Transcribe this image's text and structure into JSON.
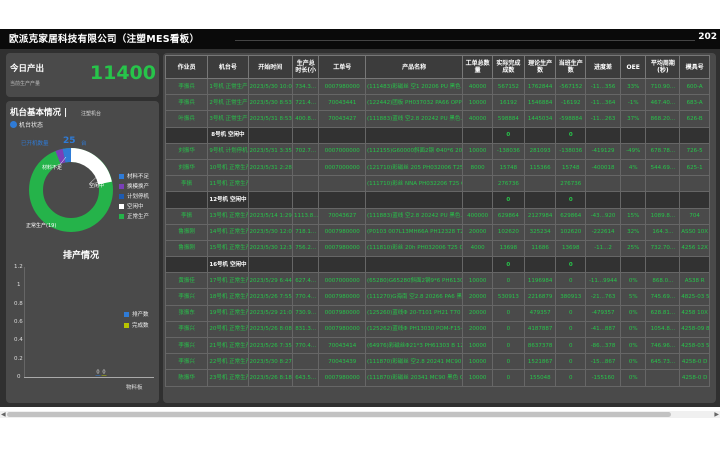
{
  "header": {
    "title": "欧派克家居科技有限公司（注塑MES看板）",
    "year": "202"
  },
  "today": {
    "title": "今日产出",
    "sub": "当前生产产量",
    "value": "11400"
  },
  "machine": {
    "title": "机台基本情况 |",
    "subtab": "注塑机台",
    "status_label": "机台状态",
    "count_label": "已开机数量",
    "count_value": "25",
    "count_unit": "台",
    "legend": [
      {
        "label": "材料不足",
        "color": "#2f7bd6"
      },
      {
        "label": "换模换产",
        "color": "#7a3fb8"
      },
      {
        "label": "计划停机",
        "color": "#1e5bb0"
      },
      {
        "label": "空闲中",
        "color": "#ffffff"
      },
      {
        "label": "正常生产",
        "color": "#25b34a"
      }
    ],
    "donut_labels": {
      "a": "材料不足",
      "b": "空闲中",
      "c": "正常生产(19)"
    }
  },
  "chart_data": {
    "type": "bar",
    "title": "排产情况",
    "categories": [
      "物料板"
    ],
    "series": [
      {
        "name": "排产数",
        "color": "#2f7bd6",
        "values": [
          0
        ]
      },
      {
        "name": "完成数",
        "color": "#b8c400",
        "values": [
          0
        ]
      }
    ],
    "ylim": [
      0,
      1.2
    ],
    "yticks": [
      "1.2",
      "1",
      "0.8",
      "0.6",
      "0.4",
      "0.2",
      "0"
    ]
  },
  "table": {
    "headers": [
      "作业员",
      "机台号",
      "开始时间",
      "生产总时长(小",
      "工单号",
      "产品名称",
      "工单总数量",
      "实际完成成数",
      "理论生产数",
      "当班生产数",
      "进度差",
      "OEE",
      "平均周期(秒)",
      "模具号"
    ],
    "rows": [
      {
        "cls": "",
        "cells": [
          "李振兵",
          "1号机 正常生产",
          "2023/5/30 10:00",
          "734.3...",
          "0007980000",
          "(111483)彩磁丝 空1 20206 PU 黑色 C05161E40660...",
          "40000",
          "567152",
          "1762844",
          "-567152",
          "-11...356",
          "33%",
          "710.90...",
          "600-A"
        ]
      },
      {
        "cls": "",
        "cells": [
          "李振兵",
          "2号机 正常生产",
          "2023/5/30 8:53",
          "721.4...",
          "70043441",
          "(122442)团板 PH037032 PA66 OPP05 5...",
          "10000",
          "16192",
          "1546884",
          "-16192",
          "-11...364",
          "-1%",
          "467.40...",
          "683-A"
        ]
      },
      {
        "cls": "",
        "cells": [
          "叶振兵",
          "3号机 正常生产",
          "2023/5/31 8:53",
          "400.8...",
          "70043427",
          "(111883)蓝线 空2.8 20242 PU 黑色...",
          "40000",
          "598884",
          "1445034",
          "-598884",
          "-11...263",
          "37%",
          "868.20...",
          "626-B"
        ]
      },
      {
        "cls": "hl",
        "cells": [
          "",
          "8号机 空闲中",
          "",
          "",
          "",
          "",
          "",
          "0",
          "",
          "0",
          "",
          "",
          "",
          ""
        ]
      },
      {
        "cls": "",
        "cells": [
          "刘振华",
          "9号机 计划停机",
          "2023/5/31 3:35",
          "702.7...",
          "0007000000",
          "(112155)G60000斜面2钢 Φ40*6 2041 1B POM-F15-...",
          "10000",
          "-138036",
          "281093",
          "-138036",
          "-419129",
          "-49%",
          "678.78...",
          "726-5"
        ]
      },
      {
        "cls": "",
        "cells": [
          "刘振华",
          "10号机 正常生产",
          "2023/5/31 2:28",
          "",
          "0007000000",
          "(121710)彩磁丝 205 PH032006 T25 OPP05...",
          "8000",
          "15748",
          "115366",
          "15748",
          "-400018",
          "4%",
          "544.69...",
          "625-1"
        ]
      },
      {
        "cls": "",
        "cells": [
          "李振",
          "11号机 正常生产",
          "",
          "",
          "",
          "(111710)彩丝 NNA PH032206 T25 OPP05...",
          "",
          "276736",
          "",
          "276736",
          "",
          "",
          "",
          ""
        ]
      },
      {
        "cls": "hl",
        "cells": [
          "",
          "12号机 空闲中",
          "",
          "",
          "",
          "",
          "",
          "0",
          "",
          "0",
          "",
          "",
          "",
          ""
        ]
      },
      {
        "cls": "",
        "cells": [
          "李振",
          "13号机 正常生产",
          "2023/5/14 1:29",
          "1113.8...",
          "70043627",
          "(111883)蓝线 空2.8 20242 PU 黑色...",
          "400000",
          "629864",
          "2127984",
          "629864",
          "-43...920",
          "15%",
          "1089.8...",
          "704"
        ]
      },
      {
        "cls": "",
        "cells": [
          "鲁振刚",
          "14号机 正常生产",
          "2023/5/30 12:01",
          "718.1...",
          "0007980000",
          "(P0103 007L13MH66A PH12328 T25 OPP...",
          "20000",
          "102620",
          "325234",
          "102620",
          "-222614",
          "32%",
          "164.3...",
          "ASS0 10X"
        ]
      },
      {
        "cls": "",
        "cells": [
          "鲁振刚",
          "15号机 正常生产",
          "2023/5/30 12:37",
          "756.2...",
          "0007980000",
          "(111810)彩丝 20h PH032006 T25 OPP05...",
          "4000",
          "13698",
          "11686",
          "13698",
          "-11...2",
          "25%",
          "732.70...",
          "4256 12X"
        ]
      },
      {
        "cls": "hl",
        "cells": [
          "",
          "16号机 空闲中",
          "",
          "",
          "",
          "",
          "",
          "0",
          "",
          "0",
          "",
          "",
          "",
          ""
        ]
      },
      {
        "cls": "",
        "cells": [
          "黄振佳",
          "17号机 正常生产",
          "2023/5/29 6:44",
          "627.4...",
          "0007000000",
          "(65280)G65280斜面2钢9*6 PH61303 B 125...",
          "10000",
          "0",
          "1196984",
          "0",
          "-11...9944",
          "0%",
          "868.0...",
          "AS38 R"
        ]
      },
      {
        "cls": "",
        "cells": [
          "李振兴",
          "18号机 正常生产",
          "2023/5/26 7:55",
          "770.4...",
          "0007980000",
          "(111270)G海南 空2.8 20266 PA6 黑色 OPP 1PHH01...",
          "20000",
          "530913",
          "2216879",
          "380913",
          "-21...763",
          "5%",
          "745.69...",
          "4825-03 5X"
        ]
      },
      {
        "cls": "",
        "cells": [
          "张振东",
          "19号机 正常生产",
          "2023/5/29 21:02",
          "730.9...",
          "0007980000",
          "(125260)蓝线Φ 20-T101 PH21 T70 6W...",
          "20000",
          "0",
          "479357",
          "0",
          "-479357",
          "0%",
          "628.81...",
          "4258 10X"
        ]
      },
      {
        "cls": "",
        "cells": [
          "李振兴",
          "20号机 正常生产",
          "2023/5/26 8:08",
          "831.3...",
          "0007980000",
          "(125262)蓝线Φ PH13030 POM-F15-...",
          "20000",
          "0",
          "4187887",
          "0",
          "-41...887",
          "0%",
          "1054.8...",
          "4258-09 8X"
        ]
      },
      {
        "cls": "",
        "cells": [
          "李振兴",
          "21号机 正常生产",
          "2023/5/26 7:35",
          "770.4...",
          "70043414",
          "(64976)彩磁丝Φ21*3 PH61303 B 125...",
          "10000",
          "0",
          "8637378",
          "0",
          "-86...378",
          "0%",
          "746.96...",
          "4258-03 5X"
        ]
      },
      {
        "cls": "",
        "cells": [
          "李振兴",
          "22号机 正常生产",
          "2023/5/30 8:27",
          "",
          "70043439",
          "(111870)彩磁丝 空2.8 20241 MC90 黑色 OPP...",
          "10000",
          "0",
          "1521867",
          "0",
          "-15...867",
          "0%",
          "645.73...",
          "4258-0 D"
        ]
      },
      {
        "cls": "",
        "cells": [
          "陈振华",
          "23号机 正常生产",
          "2023/5/26 8:18",
          "643.5...",
          "0007980000",
          "(111870)彩磁丝 20341 MC90 黑色 OPP05...",
          "10000",
          "0",
          "155048",
          "0",
          "-155160",
          "0%",
          "",
          "4258-0 D"
        ]
      }
    ]
  }
}
